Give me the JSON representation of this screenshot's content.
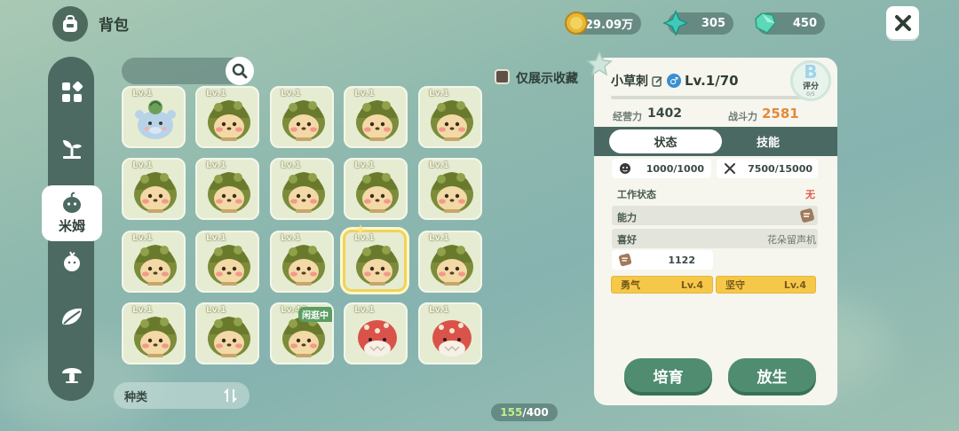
{
  "header": {
    "title": "背包"
  },
  "currencies": [
    {
      "name": "gold",
      "value": "29.09万",
      "color": "#e7b833"
    },
    {
      "name": "star",
      "value": "305",
      "color": "#3fc9b9"
    },
    {
      "name": "crystal",
      "value": "450",
      "color": "#5bd9b8"
    }
  ],
  "nav": {
    "items": [
      {
        "icon": "grid-icon"
      },
      {
        "icon": "sprout-icon"
      },
      {
        "icon": "mimu-icon",
        "label": "米姆",
        "active": true
      },
      {
        "icon": "seed-icon"
      },
      {
        "icon": "leaf-icon"
      },
      {
        "icon": "mushroom-icon"
      }
    ]
  },
  "search": {
    "placeholder": ""
  },
  "favorites": {
    "label": "仅展示收藏",
    "checked": false
  },
  "grid": [
    {
      "level": "Lv.1",
      "creature": "bluebeast"
    },
    {
      "level": "Lv.1",
      "creature": "hedgehog"
    },
    {
      "level": "Lv.1",
      "creature": "hedgehog"
    },
    {
      "level": "Lv.1",
      "creature": "hedgehog"
    },
    {
      "level": "Lv.1",
      "creature": "hedgehog"
    },
    {
      "level": "Lv.1",
      "creature": "hedgehog"
    },
    {
      "level": "Lv.1",
      "creature": "hedgehog"
    },
    {
      "level": "Lv.1",
      "creature": "hedgehog"
    },
    {
      "level": "Lv.1",
      "creature": "hedgehog"
    },
    {
      "level": "Lv.1",
      "creature": "hedgehog"
    },
    {
      "level": "Lv.1",
      "creature": "hedgehog"
    },
    {
      "level": "Lv.1",
      "creature": "hedgehog"
    },
    {
      "level": "Lv.1",
      "creature": "hedgehog"
    },
    {
      "level": "Lv.1",
      "creature": "hedgehog",
      "selected": true
    },
    {
      "level": "Lv.1",
      "creature": "hedgehog"
    },
    {
      "level": "Lv.1",
      "creature": "hedgehog"
    },
    {
      "level": "Lv.1",
      "creature": "hedgehog"
    },
    {
      "level": "Lv.40",
      "creature": "hedgehog",
      "badge": "闲逛中"
    },
    {
      "level": "Lv.1",
      "creature": "redbeast"
    },
    {
      "level": "Lv.1",
      "creature": "redbeast"
    }
  ],
  "sort": {
    "label": "种类"
  },
  "capacity": {
    "current": "155",
    "max": "/400"
  },
  "detail": {
    "name": "小草刺",
    "gender": "♂",
    "level": "Lv.1/70",
    "rank": {
      "letter": "B",
      "label": "评分",
      "sub": "0/5"
    },
    "manage_label": "经营力",
    "manage_value": "1402",
    "combat_label": "战斗力",
    "combat_value": "2581",
    "tabs": [
      "状态",
      "技能"
    ],
    "mood": "1000/1000",
    "food": "7500/15000",
    "work_label": "工作状态",
    "work_value": "无",
    "ability_label": "能力",
    "hobby_label": "喜好",
    "hobby_value": "花朵留声机",
    "ability_points": "1122",
    "traits": [
      {
        "name": "勇气",
        "level": "Lv.4"
      },
      {
        "name": "坚守",
        "level": "Lv.4"
      }
    ],
    "actions": {
      "cultivate": "培育",
      "release": "放生"
    }
  }
}
